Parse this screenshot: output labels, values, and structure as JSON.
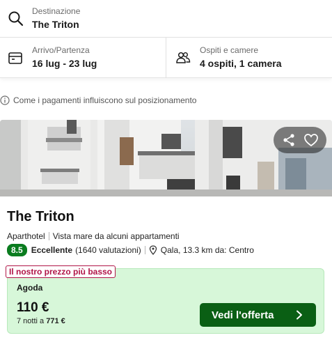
{
  "search": {
    "destination_label": "Destinazione",
    "destination_value": "The Triton",
    "dates_label": "Arrivo/Partenza",
    "dates_value": "16 lug - 23 lug",
    "guests_label": "Ospiti e camere",
    "guests_value": "4 ospiti, 1 camera"
  },
  "info_note": "Come i pagamenti influiscono sul posizionamento",
  "hotel": {
    "name": "The Triton",
    "type": "Aparthotel",
    "feature": "Vista mare da alcuni appartamenti",
    "score": "8.5",
    "rating_word": "Eccellente",
    "reviews": "(1640 valutazioni)",
    "location": "Qala, 13.3 km da: Centro"
  },
  "offer": {
    "badge": "Il nostro prezzo più basso",
    "provider": "Agoda",
    "price": "110 €",
    "nights_prefix": "7 notti a",
    "total": "771 €",
    "cta_label": "Vedi l'offerta"
  },
  "colors": {
    "score_green": "#0a7c1f",
    "cta_green": "#0a5f14",
    "offer_bg": "#d7f7d9",
    "badge_red": "#b01547"
  },
  "icons": [
    "search-icon",
    "calendar-icon",
    "guests-icon",
    "info-icon",
    "share-icon",
    "heart-icon",
    "location-pin-icon",
    "chevron-right-icon"
  ]
}
